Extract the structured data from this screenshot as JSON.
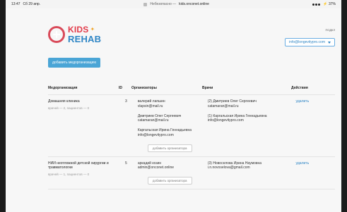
{
  "status_bar": {
    "time": "13:47",
    "date": "Сб 29 апр.",
    "url_prefix": "Небезопасно —",
    "url_domain": "kids.onconet.online",
    "battery": "⚡ 37%"
  },
  "header": {
    "logo_text_top": "KIDS",
    "logo_text_bottom": "REHAB",
    "user_label": "ПОДКЛ",
    "user_email": "info@longevitypro.com"
  },
  "toolbar": {
    "add_med_org_label": "добавить медорганизацию"
  },
  "table": {
    "headers": {
      "org": "Медорганизация",
      "id": "ID",
      "organizers": "Организаторы",
      "doctors": "Врачи",
      "actions": "Действия"
    },
    "rows": [
      {
        "org_name": "Домашняя клиника",
        "org_meta": "врачей — 2, пациентов — 0",
        "id": "3",
        "organizers": [
          {
            "name": "валерий лапшин",
            "email": "vlapsin@mail.ru"
          },
          {
            "name": "Дмитриев Олег Сергеевич",
            "email": "catamaran@mail.ru"
          },
          {
            "name": "Каргальская Ирина Геннадьевна",
            "email": "info@longevitypro.com"
          }
        ],
        "add_organizer_label": "добавить организатора",
        "doctors": [
          {
            "name": "(2) Дмитриев Олег Сергеевич",
            "email": "catamaran@mail.ru"
          },
          {
            "name": "(1) Каргальская Ирина Геннадьевна",
            "email": "info@longevitypro.com"
          }
        ],
        "action_label": "удалить"
      },
      {
        "org_name": "НИИ неотложной детской хирургии и травматологии",
        "org_meta": "врачей — 1, пациентов — 0",
        "id": "5",
        "organizers": [
          {
            "name": "аркадий козин",
            "email": "admin@onconet.online"
          }
        ],
        "add_organizer_label": "добавить организатора",
        "doctors": [
          {
            "name": "(3) Новоселова Ирина Наумовна",
            "email": "i.n.novoselova@gmail.com"
          }
        ],
        "action_label": "удалить"
      }
    ]
  },
  "colors": {
    "accent_blue": "#2f86c5",
    "button_blue": "#4aa5d6",
    "logo_red": "#e23b4a",
    "logo_orange": "#f0a72f"
  }
}
